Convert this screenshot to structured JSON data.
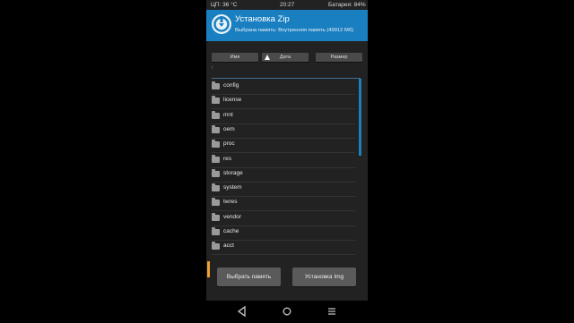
{
  "status": {
    "cpu": "ЦП: 36 °C",
    "time": "20:27",
    "battery": "Батарея: 84%"
  },
  "header": {
    "title": "Установка Zip",
    "subtitle": "Выбрана память: Внутренняя память (49912 Мб)"
  },
  "sort": {
    "name": "Имя",
    "date": "Дата",
    "size": "Размер"
  },
  "path": "/",
  "files": [
    "config",
    "license",
    "mnt",
    "oem",
    "proc",
    "res",
    "storage",
    "system",
    "twres",
    "vendor",
    "cache",
    "acct"
  ],
  "buttons": {
    "select_storage": "Выбрать память",
    "install_img": "Установка Img"
  },
  "colors": {
    "accent": "#1a7fc1",
    "background": "#222222",
    "button": "#5a5a5a",
    "indicator": "#f0a030"
  },
  "nav": {
    "back": "back-icon",
    "home": "home-icon",
    "menu": "menu-icon"
  }
}
